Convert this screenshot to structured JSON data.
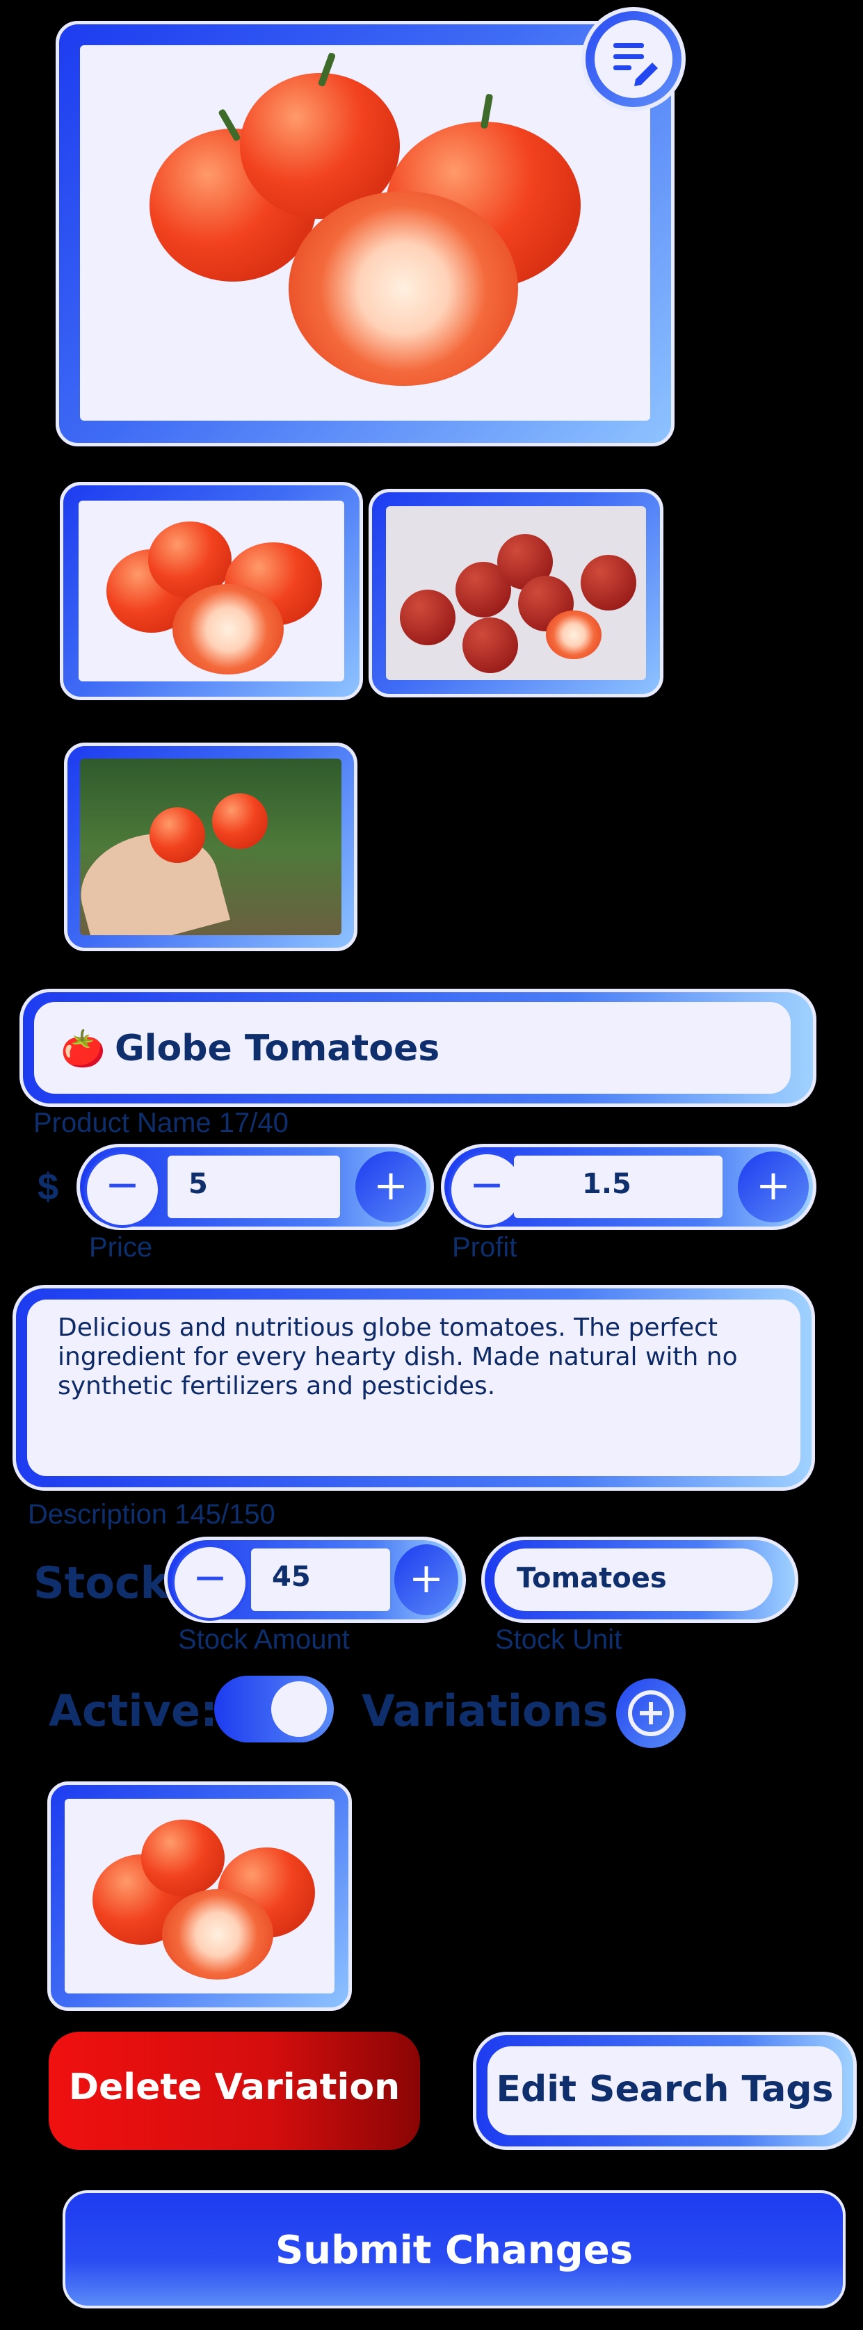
{
  "product": {
    "name": "Globe Tomatoes",
    "name_counter": "Product Name 17/40"
  },
  "price": {
    "currency": "$",
    "value": "5",
    "label": "Price"
  },
  "profit": {
    "value": "1.5",
    "label": "Profit"
  },
  "description": {
    "text": "Delicious and nutritious globe tomatoes. The perfect ingredient for every hearty dish. Made natural with no synthetic fertilizers and pesticides.",
    "counter": "Description 145/150"
  },
  "stock": {
    "title": "Stock",
    "amount": "45",
    "amount_label": "Stock Amount",
    "unit": "Tomatoes",
    "unit_label": "Stock Unit"
  },
  "active": {
    "label": "Active:",
    "on": true
  },
  "variations": {
    "label": "Variations"
  },
  "buttons": {
    "delete_variation": "Delete Variation",
    "edit_search_tags": "Edit Search Tags",
    "submit": "Submit Changes"
  },
  "icons": {
    "edit": "edit-list-icon",
    "minus": "minus-icon",
    "plus": "plus-icon",
    "add_variation": "add-circle-icon"
  },
  "colors": {
    "accent": "#2246f0",
    "text_dark": "#0e2e6c",
    "delete_red": "#e01010",
    "panel": "#f0f0ff"
  }
}
